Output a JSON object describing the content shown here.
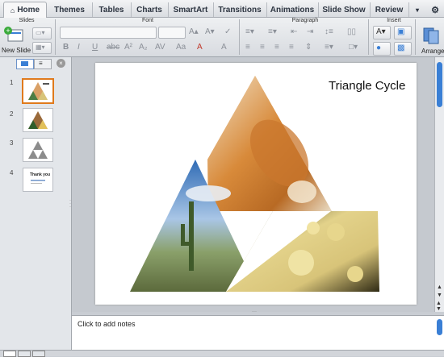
{
  "tabs": [
    {
      "label": "Home",
      "active": true
    },
    {
      "label": "Themes"
    },
    {
      "label": "Tables"
    },
    {
      "label": "Charts"
    },
    {
      "label": "SmartArt"
    },
    {
      "label": "Transitions"
    },
    {
      "label": "Animations"
    },
    {
      "label": "Slide Show"
    },
    {
      "label": "Review"
    }
  ],
  "ribbon": {
    "groups": {
      "slides": "Slides",
      "font": "Font",
      "paragraph": "Paragraph",
      "insert": "Insert"
    },
    "new_slide_label": "New Slide",
    "arrange_label": "Arrange"
  },
  "slide_numbers": [
    "1",
    "2",
    "3",
    "4"
  ],
  "thumb4_title": "Thank you",
  "slide": {
    "title": "Triangle Cycle"
  },
  "notes": {
    "placeholder": "Click to add notes"
  },
  "colors": {
    "selected_border": "#e07a1c",
    "scroll_blue": "#3a7fd5"
  },
  "icons": [
    "home-icon",
    "gear-icon",
    "new-slide-icon",
    "layout-icon",
    "close-icon",
    "arrange-icon"
  ]
}
